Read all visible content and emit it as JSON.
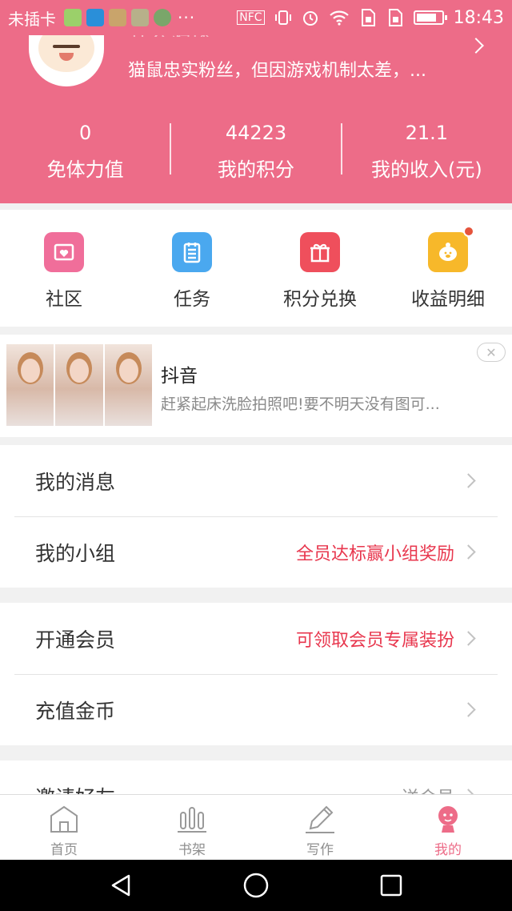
{
  "status_bar": {
    "carrier": "未插卡",
    "overflow": "···",
    "nfc": "NFC",
    "time": "18:43",
    "battery_level": 0.8,
    "icons": [
      "wechat-icon",
      "video-app-icon",
      "gallery-icon",
      "gallery-icon",
      "cloud-icon",
      "nfc-icon",
      "vibrate-icon",
      "alarm-icon",
      "wifi-icon",
      "sim-icon",
      "sim-icon",
      "battery-icon"
    ]
  },
  "profile": {
    "name": "齐云鸿逸",
    "bio": "猫鼠忠实粉丝，但因游戏机制太差，..."
  },
  "stats": [
    {
      "value": "0",
      "label": "免体力值"
    },
    {
      "value": "44223",
      "label": "我的积分"
    },
    {
      "value": "21.1",
      "label": "我的收入(元)"
    }
  ],
  "quick_menu": [
    {
      "label": "社区",
      "icon": "community-heart-icon",
      "color": "#f06e9a"
    },
    {
      "label": "任务",
      "icon": "task-list-icon",
      "color": "#4aa8ef"
    },
    {
      "label": "积分兑换",
      "icon": "gift-icon",
      "color": "#ef4f5c"
    },
    {
      "label": "收益明细",
      "icon": "piggy-bank-icon",
      "color": "#f7b82a",
      "badge": true
    }
  ],
  "ad": {
    "title": "抖音",
    "description": "赶紧起床洗脸拍照吧!要不明天没有图可..."
  },
  "sections": [
    [
      {
        "label": "我的消息",
        "hint": ""
      },
      {
        "label": "我的小组",
        "hint": "全员达标赢小组奖励"
      }
    ],
    [
      {
        "label": "开通会员",
        "hint": "可领取会员专属装扮"
      },
      {
        "label": "充值金币",
        "hint": ""
      }
    ],
    [
      {
        "label": "邀请好友",
        "hint": "送会员"
      }
    ]
  ],
  "bottom_nav": [
    {
      "label": "首页",
      "icon": "home-icon",
      "active": false
    },
    {
      "label": "书架",
      "icon": "bookshelf-icon",
      "active": false
    },
    {
      "label": "写作",
      "icon": "pen-icon",
      "active": false
    },
    {
      "label": "我的",
      "icon": "profile-icon",
      "active": true
    }
  ],
  "colors": {
    "brand": "#ed6c88",
    "accent_text": "#e8374e",
    "inactive_nav": "#8f8f8f"
  }
}
